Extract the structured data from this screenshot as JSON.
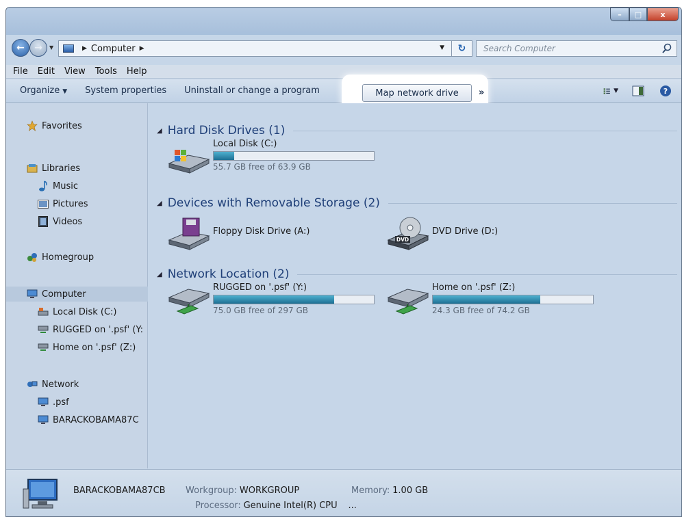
{
  "window": {
    "minimize_glyph": "–",
    "maximize_glyph": "□",
    "close_glyph": "x"
  },
  "address": {
    "crumbs": [
      "Computer"
    ],
    "search_placeholder": "Search Computer"
  },
  "menu": [
    "File",
    "Edit",
    "View",
    "Tools",
    "Help"
  ],
  "commands": {
    "organize": "Organize",
    "system_properties": "System properties",
    "uninstall": "Uninstall or change a program",
    "map_network_drive": "Map network drive",
    "more": "»"
  },
  "sidebar": {
    "favorites": "Favorites",
    "libraries": "Libraries",
    "music": "Music",
    "pictures": "Pictures",
    "videos": "Videos",
    "homegroup": "Homegroup",
    "computer": "Computer",
    "local_disk": "Local Disk (C:)",
    "rugged": "RUGGED on '.psf' (Y:",
    "home": "Home on '.psf' (Z:)",
    "network": "Network",
    "psf": ".psf",
    "barack": "BARACKOBAMA87C"
  },
  "groups": {
    "hdd": "Hard Disk Drives (1)",
    "removable": "Devices with Removable Storage (2)",
    "network": "Network Location (2)"
  },
  "drives": {
    "c": {
      "name": "Local Disk (C:)",
      "free": "55.7 GB free of 63.9 GB",
      "used_fraction": 0.13
    },
    "a": {
      "name": "Floppy Disk Drive (A:)"
    },
    "d": {
      "name": "DVD Drive (D:)",
      "badge": "DVD"
    },
    "y": {
      "name": "RUGGED on '.psf' (Y:)",
      "free": "75.0 GB free of 297 GB",
      "used_fraction": 0.75
    },
    "z": {
      "name": "Home on '.psf' (Z:)",
      "free": "24.3 GB free of 74.2 GB",
      "used_fraction": 0.67
    }
  },
  "details": {
    "computer_name": "BARACKOBAMA87CB",
    "workgroup_label": "Workgroup:",
    "workgroup_value": "WORKGROUP",
    "memory_label": "Memory:",
    "memory_value": "1.00 GB",
    "processor_label": "Processor:",
    "processor_value": "Genuine Intel(R) CPU",
    "processor_ellipsis": "..."
  },
  "colors": {
    "bar_fill": "#2a86ad",
    "group_title": "#1f3f78",
    "highlight": "#ffffff"
  }
}
